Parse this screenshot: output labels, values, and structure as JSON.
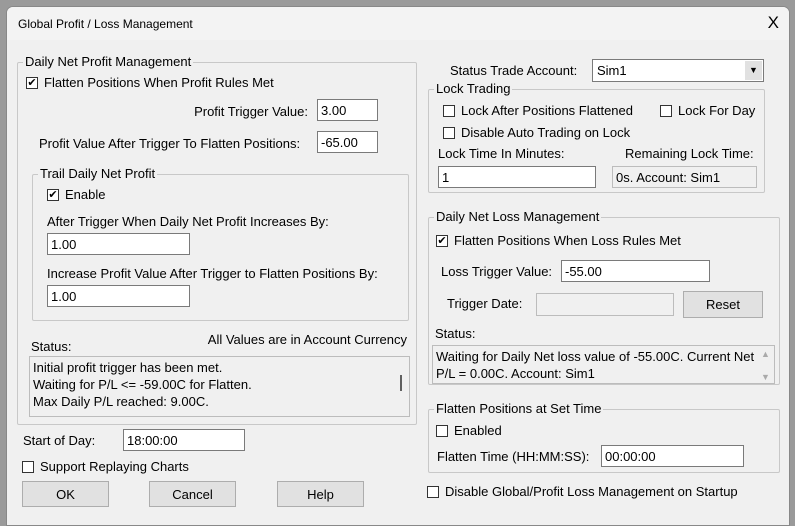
{
  "window": {
    "title": "Global Profit / Loss Management",
    "close": "X"
  },
  "profit": {
    "group": "Daily Net Profit Management",
    "flatten_label": "Flatten Positions When Profit Rules Met",
    "flatten_checked": true,
    "trigger_label": "Profit Trigger Value:",
    "trigger_value": "3.00",
    "after_label": "Profit Value After Trigger To Flatten Positions:",
    "after_value": "-65.00",
    "trail": {
      "group": "Trail Daily Net Profit",
      "enable_label": "Enable",
      "enable_checked": true,
      "increase_by_label": "After Trigger When Daily Net Profit Increases By:",
      "increase_by_value": "1.00",
      "increase_flatten_label": "Increase Profit Value After Trigger to Flatten Positions By:",
      "increase_flatten_value": "1.00"
    },
    "status_label": "Status:",
    "currency_note": "All Values are in Account Currency",
    "status_lines": [
      "Initial profit trigger has been met.",
      "Waiting for P/L <= -59.00C for Flatten.",
      "Max Daily P/L reached: 9.00C."
    ]
  },
  "start_of_day": {
    "label": "Start of Day:",
    "value": "18:00:00"
  },
  "support_replay": {
    "label": "Support Replaying Charts",
    "checked": false
  },
  "buttons": {
    "ok": "OK",
    "cancel": "Cancel",
    "help": "Help",
    "reset": "Reset"
  },
  "account": {
    "label": "Status Trade Account:",
    "value": "Sim1"
  },
  "lock": {
    "group": "Lock Trading",
    "after_flatten": "Lock After Positions Flattened",
    "for_day": "Lock For Day",
    "disable_auto": "Disable Auto Trading on Lock",
    "minutes_label": "Lock Time In Minutes:",
    "minutes_value": "1",
    "remaining_label": "Remaining Lock Time:",
    "remaining_value": "0s. Account: Sim1"
  },
  "loss": {
    "group": "Daily Net Loss Management",
    "flatten_label": "Flatten Positions When Loss Rules Met",
    "flatten_checked": true,
    "trigger_label": "Loss Trigger Value:",
    "trigger_value": "-55.00",
    "date_label": "Trigger Date:",
    "date_value": "",
    "status_label": "Status:",
    "status_lines": [
      "Waiting for Daily Net loss value of -55.00C.  Current Net",
      "P/L = 0.00C.  Account: Sim1"
    ]
  },
  "flatten_time": {
    "group": "Flatten Positions at Set Time",
    "enabled_label": "Enabled",
    "enabled_checked": false,
    "time_label": "Flatten Time (HH:MM:SS):",
    "time_value": "00:00:00"
  },
  "disable_startup": {
    "label": "Disable Global/Profit Loss Management on Startup",
    "checked": false
  }
}
